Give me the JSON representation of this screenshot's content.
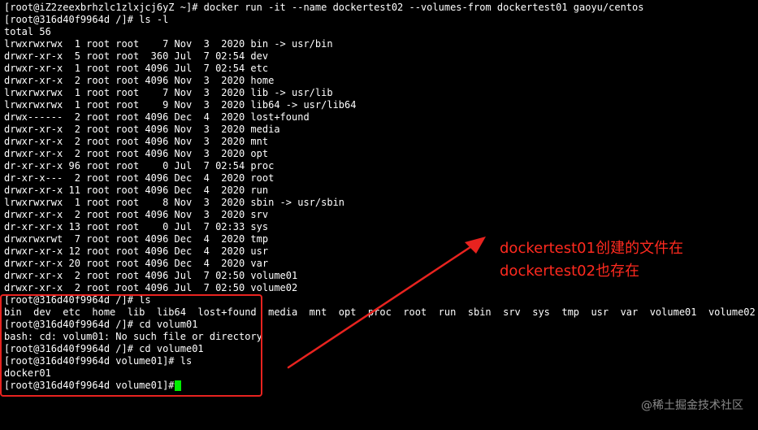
{
  "terminal": {
    "lines": [
      "[root@iZ2zeexbrhzlc1zlxjcj6yZ ~]# docker run -it --name dockertest02 --volumes-from dockertest01 gaoyu/centos",
      "[root@316d40f9964d /]# ls -l",
      "total 56",
      "lrwxrwxrwx  1 root root    7 Nov  3  2020 bin -> usr/bin",
      "drwxr-xr-x  5 root root  360 Jul  7 02:54 dev",
      "drwxr-xr-x  1 root root 4096 Jul  7 02:54 etc",
      "drwxr-xr-x  2 root root 4096 Nov  3  2020 home",
      "lrwxrwxrwx  1 root root    7 Nov  3  2020 lib -> usr/lib",
      "lrwxrwxrwx  1 root root    9 Nov  3  2020 lib64 -> usr/lib64",
      "drwx------  2 root root 4096 Dec  4  2020 lost+found",
      "drwxr-xr-x  2 root root 4096 Nov  3  2020 media",
      "drwxr-xr-x  2 root root 4096 Nov  3  2020 mnt",
      "drwxr-xr-x  2 root root 4096 Nov  3  2020 opt",
      "dr-xr-xr-x 96 root root    0 Jul  7 02:54 proc",
      "dr-xr-x---  2 root root 4096 Dec  4  2020 root",
      "drwxr-xr-x 11 root root 4096 Dec  4  2020 run",
      "lrwxrwxrwx  1 root root    8 Nov  3  2020 sbin -> usr/sbin",
      "drwxr-xr-x  2 root root 4096 Nov  3  2020 srv",
      "dr-xr-xr-x 13 root root    0 Jul  7 02:33 sys",
      "drwxrwxrwt  7 root root 4096 Dec  4  2020 tmp",
      "drwxr-xr-x 12 root root 4096 Dec  4  2020 usr",
      "drwxr-xr-x 20 root root 4096 Dec  4  2020 var",
      "drwxr-xr-x  2 root root 4096 Jul  7 02:50 volume01",
      "drwxr-xr-x  2 root root 4096 Jul  7 02:50 volume02",
      "[root@316d40f9964d /]# ls",
      "bin  dev  etc  home  lib  lib64  lost+found  media  mnt  opt  proc  root  run  sbin  srv  sys  tmp  usr  var  volume01  volume02",
      "[root@316d40f9964d /]# cd volum01",
      "bash: cd: volum01: No such file or directory",
      "[root@316d40f9964d /]# cd volume01",
      "[root@316d40f9964d volume01]# ls",
      "docker01",
      "[root@316d40f9964d volume01]# "
    ]
  },
  "annotation": {
    "line1": "dockertest01创建的文件在",
    "line2": "dockertest02也存在"
  },
  "watermark": "@稀土掘金技术社区",
  "colors": {
    "background": "#000000",
    "text": "#ffffff",
    "cursor": "#00ee00",
    "annotation": "#ff2a1f",
    "watermark": "#8a8a8a"
  }
}
